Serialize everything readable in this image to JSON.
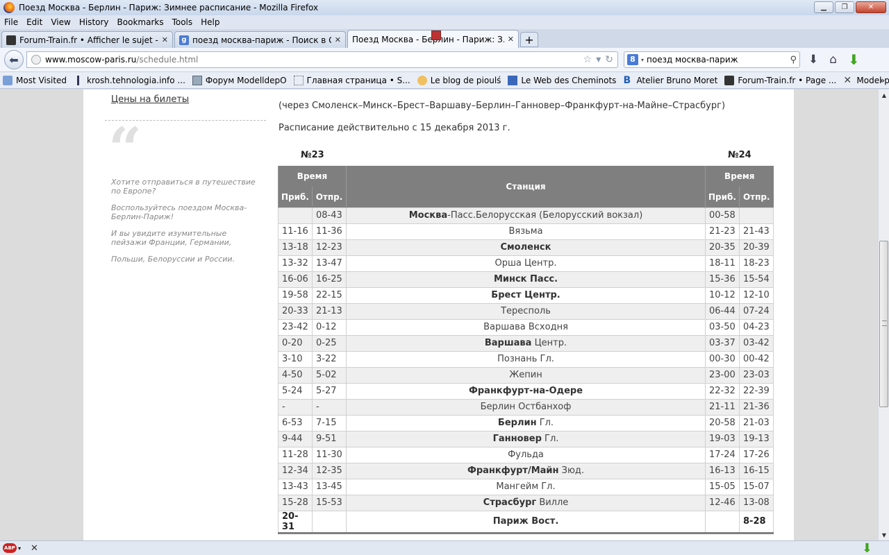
{
  "window": {
    "title": "Поезд Москва - Берлин - Париж: Зимнее расписание - Mozilla Firefox",
    "minimize": "▁",
    "maximize": "❐",
    "close": "✕"
  },
  "menu": [
    "File",
    "Edit",
    "View",
    "History",
    "Bookmarks",
    "Tools",
    "Help"
  ],
  "tabs": [
    {
      "label": "Forum-Train.fr • Afficher le sujet - co...",
      "icon": "train-icon"
    },
    {
      "label": "поезд москва-париж - Поиск в Goo...",
      "icon": "google-icon"
    },
    {
      "label": "Поезд Москва - Берлин - Париж: З...",
      "icon": "page-icon",
      "active": true
    }
  ],
  "newtab": "+",
  "tab_close": "✕",
  "nav": {
    "back": "⬅",
    "url_host": "www.moscow-paris.ru",
    "url_path": "/schedule.html",
    "star": "☆",
    "dropdown": "▾",
    "reload": "↻",
    "search_value": "поезд москва-париж",
    "search_engine": "8",
    "search_btn": "⚲",
    "download": "⬇",
    "home": "⌂",
    "addon": "⬇"
  },
  "bookmarks": [
    {
      "label": "Most Visited"
    },
    {
      "label": "krosh.tehnologia.info ..."
    },
    {
      "label": "Форум ModelldepO"
    },
    {
      "label": "Главная страница • S..."
    },
    {
      "label": "Le blog de pioulś"
    },
    {
      "label": "Le Web des Cheminots"
    },
    {
      "label": "Atelier Bruno Moret"
    },
    {
      "label": "Forum-Train.fr • Page ..."
    },
    {
      "label": "Model paint database"
    }
  ],
  "bookmarks_more": "»",
  "sidebar": {
    "link": "Цены на билеты",
    "quote_mark": "“",
    "texts": [
      "Хотите отправиться в путешествие по Европе?",
      "Воспользуйтесь поездом Москва-Берлин-Париж!",
      "И вы увидите изумительные пейзажи Франции, Германии,",
      "Польши, Белоруссии и России."
    ]
  },
  "content": {
    "route": "(через Смоленск–Минск–Брест–Варшаву–Берлин–Ганновер–Франкфурт-на-Майне–Страсбург)",
    "validity": "Расписание действительно с 15 декабря 2013 г.",
    "train_left": "№23",
    "train_right": "№24",
    "headers": {
      "time": "Время",
      "station": "Станция",
      "arr": "Приб.",
      "dep": "Отпр."
    },
    "rows": [
      {
        "a23": "",
        "d23": "08-43",
        "station_bold": "Москва",
        "station_rest": "-Пасс.Белорусская (Белорусский вокзал)",
        "a24": "00-58",
        "d24": ""
      },
      {
        "a23": "11-16",
        "d23": "11-36",
        "station_bold": "",
        "station_rest": "Вязьма",
        "a24": "21-23",
        "d24": "21-43"
      },
      {
        "a23": "13-18",
        "d23": "12-23",
        "station_bold": "Смоленск",
        "station_rest": "",
        "a24": "20-35",
        "d24": "20-39"
      },
      {
        "a23": "13-32",
        "d23": "13-47",
        "station_bold": "",
        "station_rest": "Орша Центр.",
        "a24": "18-11",
        "d24": "18-23"
      },
      {
        "a23": "16-06",
        "d23": "16-25",
        "station_bold": "Минск Пасс.",
        "station_rest": "",
        "a24": "15-36",
        "d24": "15-54"
      },
      {
        "a23": "19-58",
        "d23": "22-15",
        "station_bold": "Брест Центр.",
        "station_rest": "",
        "a24": "10-12",
        "d24": "12-10"
      },
      {
        "a23": "20-33",
        "d23": "21-13",
        "station_bold": "",
        "station_rest": "Тересполь",
        "a24": "06-44",
        "d24": "07-24"
      },
      {
        "a23": "23-42",
        "d23": "0-12",
        "station_bold": "",
        "station_rest": "Варшава Всходня",
        "a24": "03-50",
        "d24": "04-23"
      },
      {
        "a23": "0-20",
        "d23": "0-25",
        "station_bold": "Варшава",
        "station_rest": " Центр.",
        "a24": "03-37",
        "d24": "03-42"
      },
      {
        "a23": "3-10",
        "d23": "3-22",
        "station_bold": "",
        "station_rest": "Познань Гл.",
        "a24": "00-30",
        "d24": "00-42"
      },
      {
        "a23": "4-50",
        "d23": "5-02",
        "station_bold": "",
        "station_rest": "Жепин",
        "a24": "23-00",
        "d24": "23-03"
      },
      {
        "a23": "5-24",
        "d23": "5-27",
        "station_bold": "Франкфурт-на-Одере",
        "station_rest": "",
        "a24": "22-32",
        "d24": "22-39"
      },
      {
        "a23": "-",
        "d23": "-",
        "station_bold": "",
        "station_rest": "Берлин Остбанхоф",
        "a24": "21-11",
        "d24": "21-36"
      },
      {
        "a23": "6-53",
        "d23": "7-15",
        "station_bold": "Берлин",
        "station_rest": " Гл.",
        "a24": "20-58",
        "d24": "21-03"
      },
      {
        "a23": "9-44",
        "d23": "9-51",
        "station_bold": "Ганновер",
        "station_rest": " Гл.",
        "a24": "19-03",
        "d24": "19-13"
      },
      {
        "a23": "11-28",
        "d23": "11-30",
        "station_bold": "",
        "station_rest": "Фульда",
        "a24": "17-24",
        "d24": "17-26"
      },
      {
        "a23": "12-34",
        "d23": "12-35",
        "station_bold": "Франкфурт/Майн",
        "station_rest": " Зюд.",
        "a24": "16-13",
        "d24": "16-15"
      },
      {
        "a23": "13-43",
        "d23": "13-45",
        "station_bold": "",
        "station_rest": "Мангейм Гл.",
        "a24": "15-05",
        "d24": "15-07"
      },
      {
        "a23": "15-28",
        "d23": "15-53",
        "station_bold": "Страсбург",
        "station_rest": " Вилле",
        "a24": "12-46",
        "d24": "13-08"
      },
      {
        "a23": "20-31",
        "d23": "",
        "station_bold": "Париж Вост.",
        "station_rest": "",
        "a24": "",
        "d24": "8-28"
      }
    ]
  },
  "scrollbar": {
    "up": "▲",
    "down": "▼"
  },
  "status": {
    "abp": "ABP",
    "dropdown": "▾",
    "close": "✕",
    "download": "⬇"
  }
}
